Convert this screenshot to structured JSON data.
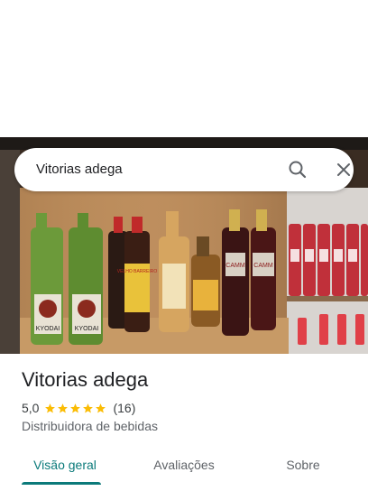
{
  "search": {
    "query": "Vitorias adega"
  },
  "photo": {
    "label_left_bottle_1": "KYODAI",
    "label_left_bottle_2": "KYODAI",
    "label_cammi_1": "CAMM",
    "label_cammi_2": "CAMM",
    "label_velho_barreiro": "VELHO BARREIRO"
  },
  "place": {
    "name": "Vitorias adega",
    "rating": "5,0",
    "stars_filled": 5,
    "review_count": "(16)",
    "category": "Distribuidora de bebidas"
  },
  "tabs": [
    {
      "label": "Visão geral",
      "active": true
    },
    {
      "label": "Avaliações",
      "active": false
    },
    {
      "label": "Sobre",
      "active": false
    }
  ],
  "colors": {
    "accent": "#0b7a7a",
    "star": "#fbbc04"
  }
}
